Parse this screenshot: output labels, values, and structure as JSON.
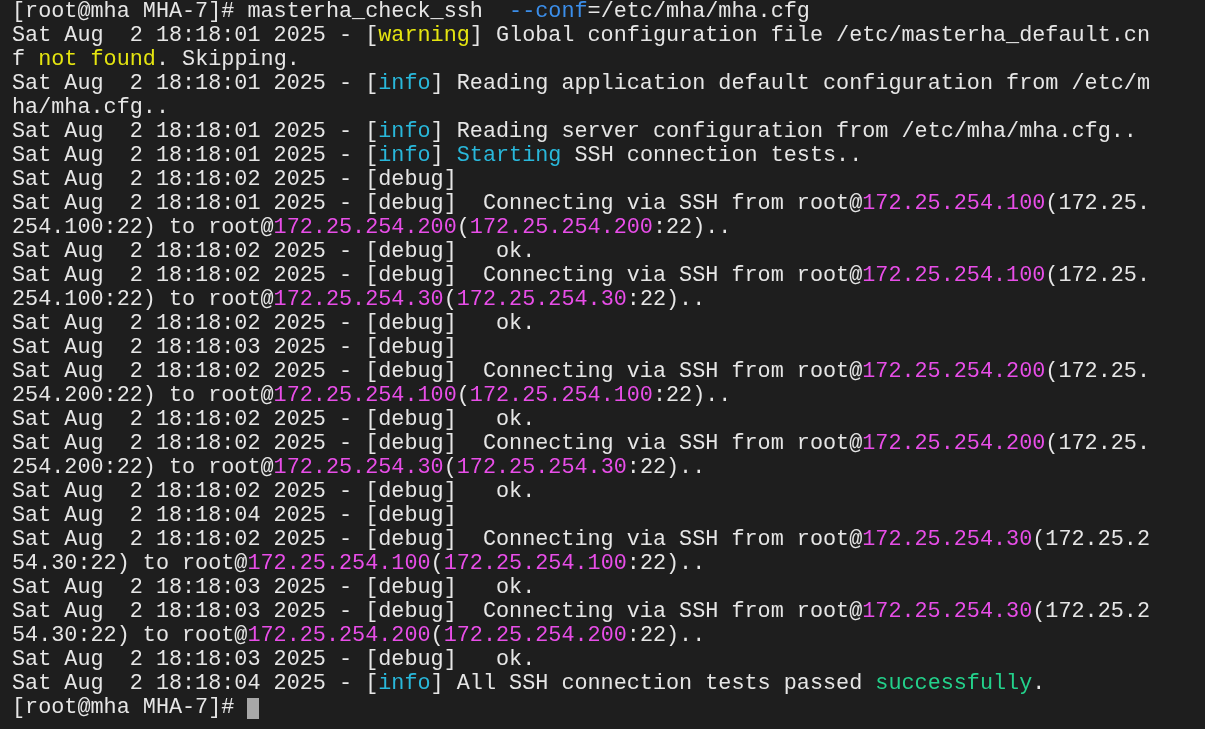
{
  "terminal": {
    "lines": [
      [
        "[root@mha MHA-7]# masterha_check_ssh  ",
        {
          "text": "--conf",
          "color": "#3b8eea"
        },
        "=/etc/mha/mha.cfg"
      ],
      [
        "Sat Aug  2 18:18:01 2025 - [",
        {
          "text": "warning",
          "color": "#e5e510"
        },
        "] Global configuration file /etc/masterha_default.cn"
      ],
      [
        "f ",
        {
          "text": "not found",
          "color": "#e5e510"
        },
        ". Skipping."
      ],
      [
        "Sat Aug  2 18:18:01 2025 - [",
        {
          "text": "info",
          "color": "#29b8db"
        },
        "] Reading application default configuration from /etc/m"
      ],
      [
        "ha/mha.cfg.."
      ],
      [
        "Sat Aug  2 18:18:01 2025 - [",
        {
          "text": "info",
          "color": "#29b8db"
        },
        "] Reading server configuration from /etc/mha/mha.cfg.."
      ],
      [
        "Sat Aug  2 18:18:01 2025 - [",
        {
          "text": "info",
          "color": "#29b8db"
        },
        "] ",
        {
          "text": "Starting",
          "color": "#29b8db"
        },
        " SSH connection tests.."
      ],
      [
        "Sat Aug  2 18:18:02 2025 - [debug]"
      ],
      [
        "Sat Aug  2 18:18:01 2025 - [debug]  Connecting via SSH from root@",
        {
          "text": "172.25.254.100",
          "color": "#e84ee8"
        },
        "(172.25."
      ],
      [
        "254.100:22) to root@",
        {
          "text": "172.25.254.200",
          "color": "#e84ee8"
        },
        "(",
        {
          "text": "172.25.254.200",
          "color": "#e84ee8"
        },
        ":22).."
      ],
      [
        "Sat Aug  2 18:18:02 2025 - [debug]   ok."
      ],
      [
        "Sat Aug  2 18:18:02 2025 - [debug]  Connecting via SSH from root@",
        {
          "text": "172.25.254.100",
          "color": "#e84ee8"
        },
        "(172.25."
      ],
      [
        "254.100:22) to root@",
        {
          "text": "172.25.254.30",
          "color": "#e84ee8"
        },
        "(",
        {
          "text": "172.25.254.30",
          "color": "#e84ee8"
        },
        ":22).."
      ],
      [
        "Sat Aug  2 18:18:02 2025 - [debug]   ok."
      ],
      [
        "Sat Aug  2 18:18:03 2025 - [debug]"
      ],
      [
        "Sat Aug  2 18:18:02 2025 - [debug]  Connecting via SSH from root@",
        {
          "text": "172.25.254.200",
          "color": "#e84ee8"
        },
        "(172.25."
      ],
      [
        "254.200:22) to root@",
        {
          "text": "172.25.254.100",
          "color": "#e84ee8"
        },
        "(",
        {
          "text": "172.25.254.100",
          "color": "#e84ee8"
        },
        ":22).."
      ],
      [
        "Sat Aug  2 18:18:02 2025 - [debug]   ok."
      ],
      [
        "Sat Aug  2 18:18:02 2025 - [debug]  Connecting via SSH from root@",
        {
          "text": "172.25.254.200",
          "color": "#e84ee8"
        },
        "(172.25."
      ],
      [
        "254.200:22) to root@",
        {
          "text": "172.25.254.30",
          "color": "#e84ee8"
        },
        "(",
        {
          "text": "172.25.254.30",
          "color": "#e84ee8"
        },
        ":22).."
      ],
      [
        "Sat Aug  2 18:18:02 2025 - [debug]   ok."
      ],
      [
        "Sat Aug  2 18:18:04 2025 - [debug]"
      ],
      [
        "Sat Aug  2 18:18:02 2025 - [debug]  Connecting via SSH from root@",
        {
          "text": "172.25.254.30",
          "color": "#e84ee8"
        },
        "(172.25.2"
      ],
      [
        "54.30:22) to root@",
        {
          "text": "172.25.254.100",
          "color": "#e84ee8"
        },
        "(",
        {
          "text": "172.25.254.100",
          "color": "#e84ee8"
        },
        ":22).."
      ],
      [
        "Sat Aug  2 18:18:03 2025 - [debug]   ok."
      ],
      [
        "Sat Aug  2 18:18:03 2025 - [debug]  Connecting via SSH from root@",
        {
          "text": "172.25.254.30",
          "color": "#e84ee8"
        },
        "(172.25.2"
      ],
      [
        "54.30:22) to root@",
        {
          "text": "172.25.254.200",
          "color": "#e84ee8"
        },
        "(",
        {
          "text": "172.25.254.200",
          "color": "#e84ee8"
        },
        ":22).."
      ],
      [
        "Sat Aug  2 18:18:03 2025 - [debug]   ok."
      ],
      [
        "Sat Aug  2 18:18:04 2025 - [",
        {
          "text": "info",
          "color": "#29b8db"
        },
        "] All SSH connection tests passed ",
        {
          "text": "successfully",
          "color": "#23d18b"
        },
        "."
      ]
    ],
    "prompt": "[root@mha MHA-7]# "
  }
}
